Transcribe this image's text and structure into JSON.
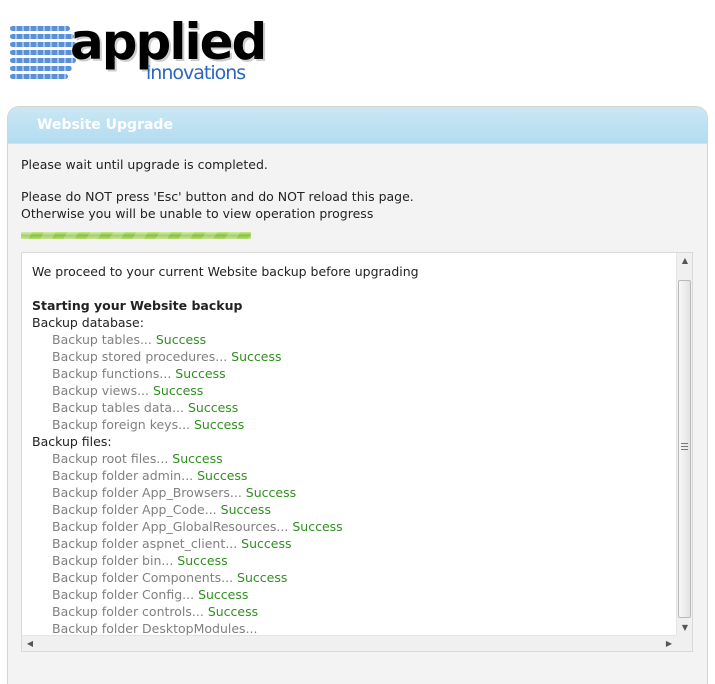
{
  "logo": {
    "word": "applied",
    "sub": "innovations"
  },
  "panel": {
    "title": "Website Upgrade"
  },
  "messages": {
    "wait": "Please wait until upgrade is completed.",
    "warning": "Please do NOT press 'Esc' button and do NOT reload this page.",
    "otherwise": "Otherwise you will be unable to view operation progress"
  },
  "progress": {
    "fraction": 0.33,
    "color": "#86c23a"
  },
  "log": {
    "intro": "We proceed to your current Website backup before upgrading",
    "heading": "Starting your Website backup",
    "db_label": "Backup database:",
    "db_items": [
      {
        "text": "Backup tables...",
        "status": "Success"
      },
      {
        "text": "Backup stored procedures...",
        "status": "Success"
      },
      {
        "text": "Backup functions...",
        "status": "Success"
      },
      {
        "text": "Backup views...",
        "status": "Success"
      },
      {
        "text": "Backup tables data...",
        "status": "Success"
      },
      {
        "text": "Backup foreign keys...",
        "status": "Success"
      }
    ],
    "files_label": "Backup files:",
    "file_items": [
      {
        "text": "Backup root files...",
        "status": "Success"
      },
      {
        "text": "Backup folder admin...",
        "status": "Success"
      },
      {
        "text": "Backup folder App_Browsers...",
        "status": "Success"
      },
      {
        "text": "Backup folder App_Code...",
        "status": "Success"
      },
      {
        "text": "Backup folder App_GlobalResources...",
        "status": "Success"
      },
      {
        "text": "Backup folder aspnet_client...",
        "status": "Success"
      },
      {
        "text": "Backup folder bin...",
        "status": "Success"
      },
      {
        "text": "Backup folder Components...",
        "status": "Success"
      },
      {
        "text": "Backup folder Config...",
        "status": "Success"
      },
      {
        "text": "Backup folder controls...",
        "status": "Success"
      },
      {
        "text": "Backup folder DesktopModules...",
        "status": ""
      }
    ]
  },
  "icons": {
    "up": "scroll-up-icon",
    "down": "scroll-down-icon",
    "left": "scroll-left-icon",
    "right": "scroll-right-icon"
  },
  "colors": {
    "success": "#2f8f1f",
    "header": "#b3dcf0"
  }
}
